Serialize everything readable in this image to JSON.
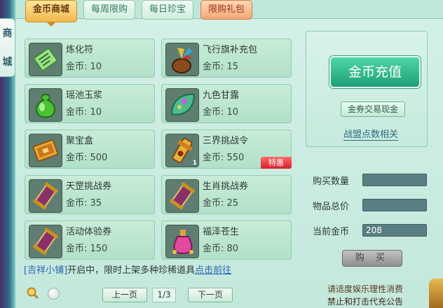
{
  "side_tab": [
    "商",
    "城"
  ],
  "tabs": [
    {
      "label": "金币商城",
      "active": true
    },
    {
      "label": "每周限购",
      "active": false
    },
    {
      "label": "每日珍宝",
      "active": false
    },
    {
      "label": "限购礼包",
      "active": false
    }
  ],
  "currency_label": "金币: ",
  "items": [
    {
      "name": "炼化符",
      "price": "10",
      "icon": "talisman-icon"
    },
    {
      "name": "飞行旗补充包",
      "price": "15",
      "icon": "flag-pack-icon"
    },
    {
      "name": "瑶池玉浆",
      "price": "10",
      "icon": "jade-potion-icon"
    },
    {
      "name": "九色甘露",
      "price": "10",
      "icon": "dew-leaf-icon"
    },
    {
      "name": "聚宝盒",
      "price": "500",
      "icon": "treasure-box-icon"
    },
    {
      "name": "三界挑战令",
      "price": "550",
      "icon": "challenge-token-icon",
      "qty": "1",
      "badge": "特惠"
    },
    {
      "name": "天罡挑战券",
      "price": "35",
      "icon": "scroll-icon"
    },
    {
      "name": "生肖挑战券",
      "price": "25",
      "icon": "scroll-icon"
    },
    {
      "name": "活动体验券",
      "price": "150",
      "icon": "scroll-icon"
    },
    {
      "name": "福泽苍生",
      "price": "80",
      "icon": "blessing-bottle-icon"
    }
  ],
  "right": {
    "recharge": "金币充值",
    "exchange": "金券交易现金",
    "alliance": "战盟点数相关",
    "quantity_label": "购买数量",
    "quantity_value": "",
    "total_label": "物品总价",
    "total_value": "",
    "current_label": "当前金币",
    "current_value": "208",
    "buy": "购 买"
  },
  "notice": {
    "shop": "[吉祥小铺]",
    "text": "开启中，限时上架多种珍稀道具",
    "link": "点击前往"
  },
  "pager": {
    "prev": "上一页",
    "page": "1/3",
    "next": "下一页"
  },
  "footer": [
    "请适度娱乐理性消费",
    "禁止和打击代充公告"
  ],
  "colors": {
    "accent": "#f0b84a",
    "recharge": "#1d9f77",
    "badge": "#d61f2b",
    "link": "#2966b5"
  }
}
